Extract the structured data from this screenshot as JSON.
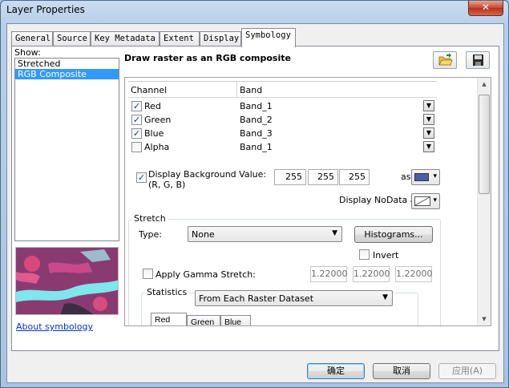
{
  "window": {
    "title": "Layer Properties",
    "close_glyph": "✕"
  },
  "tabs": [
    {
      "label": "General"
    },
    {
      "label": "Source"
    },
    {
      "label": "Key Metadata"
    },
    {
      "label": "Extent"
    },
    {
      "label": "Display"
    },
    {
      "label": "Symbology"
    }
  ],
  "show": {
    "label": "Show:",
    "items": [
      {
        "label": "Stretched"
      },
      {
        "label": "RGB Composite"
      }
    ]
  },
  "about_link": "About symbology",
  "heading": "Draw raster as an RGB composite",
  "grid": {
    "col_channel": "Channel",
    "col_band": "Band",
    "rows": [
      {
        "channel": "Red",
        "band": "Band_1",
        "checked": true
      },
      {
        "channel": "Green",
        "band": "Band_2",
        "checked": true
      },
      {
        "channel": "Blue",
        "band": "Band_3",
        "checked": true
      },
      {
        "channel": "Alpha",
        "band": "Band_1",
        "checked": false
      }
    ]
  },
  "background": {
    "label": "Display Background Value:(R, G, B)",
    "r": "255",
    "g": "255",
    "b": "255",
    "as_label": "as",
    "color": "#4a5fa8"
  },
  "nodata": {
    "label": "Display NoData as"
  },
  "stretch": {
    "group_label": "Stretch",
    "type_label": "Type:",
    "type_value": "None",
    "histograms_label": "Histograms...",
    "invert_label": "Invert",
    "gamma_label": "Apply Gamma Stretch:",
    "gamma_values": [
      "1.22000",
      "1.22000",
      "1.22000"
    ]
  },
  "statistics": {
    "group_label": "Statistics",
    "source_value": "From Each Raster Dataset",
    "tabs": [
      {
        "label": "Red"
      },
      {
        "label": "Green"
      },
      {
        "label": "Blue"
      }
    ]
  },
  "buttons": {
    "ok": "确定",
    "cancel": "取消",
    "apply": "应用(A)"
  }
}
